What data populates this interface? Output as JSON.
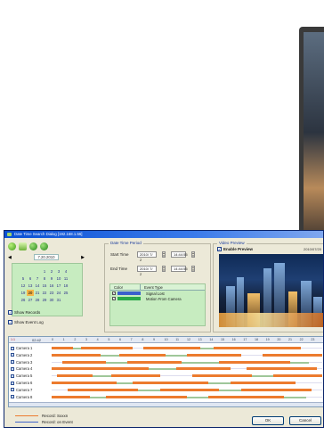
{
  "window": {
    "title": "Date Time Search Dialog  [192.168.1.56]"
  },
  "toolbar": {
    "icons": [
      "refresh-icon",
      "calendar-icon",
      "play-icon",
      "record-icon"
    ]
  },
  "calendar": {
    "nav_prev": "◀",
    "nav_next": "▶",
    "month_label": "7.20.2010",
    "days": [
      "",
      "",
      "",
      "1",
      "2",
      "3",
      "4",
      "5",
      "6",
      "7",
      "8",
      "9",
      "10",
      "11",
      "12",
      "13",
      "14",
      "15",
      "16",
      "17",
      "18",
      "19",
      "20",
      "21",
      "22",
      "23",
      "24",
      "25",
      "26",
      "27",
      "28",
      "29",
      "30",
      "31",
      "",
      ""
    ],
    "selected_day": "20"
  },
  "options": {
    "show_records": "Show Records",
    "show_event_log": "Show Event Log"
  },
  "date_time_period": {
    "title": "Date Time Period",
    "start_label": "Start Time",
    "start_date": "2010/ 7/ 2",
    "start_time": "14:44:55",
    "end_label": "End Time",
    "end_date": "2010/ 7/ 2",
    "end_time": "14:44:55"
  },
  "event_table": {
    "headers": [
      "Color",
      "Event Type"
    ],
    "rows": [
      {
        "color": "#3a5fcd",
        "label": "Signal Lost"
      },
      {
        "color": "#2aa84a",
        "label": "Motion From Camera"
      }
    ]
  },
  "video_preview": {
    "title": "Video Preview",
    "enable_label": "Enable Preview",
    "date": "2010/07/20"
  },
  "timeline": {
    "zoom": "1:1",
    "time": "02:42",
    "hours": [
      "0",
      "1",
      "2",
      "3",
      "4",
      "5",
      "6",
      "7",
      "8",
      "9",
      "10",
      "11",
      "12",
      "13",
      "14",
      "15",
      "16",
      "17",
      "18",
      "19",
      "20",
      "21",
      "22",
      "23"
    ],
    "cameras": [
      {
        "name": "Camera 1",
        "schedule": [
          [
            0.0,
            0.08
          ],
          [
            0.11,
            0.3
          ],
          [
            0.34,
            0.55
          ],
          [
            0.6,
            0.92
          ]
        ],
        "event": [
          [
            0.08,
            0.11
          ],
          [
            0.55,
            0.6
          ]
        ]
      },
      {
        "name": "Camera 2",
        "schedule": [
          [
            0.0,
            0.18
          ],
          [
            0.25,
            0.42
          ],
          [
            0.5,
            0.7
          ],
          [
            0.78,
            1.0
          ]
        ],
        "event": [
          [
            0.18,
            0.25
          ],
          [
            0.42,
            0.5
          ]
        ]
      },
      {
        "name": "Camera 3",
        "schedule": [
          [
            0.04,
            0.2
          ],
          [
            0.28,
            0.48
          ],
          [
            0.62,
            0.88
          ]
        ],
        "event": [
          [
            0.2,
            0.28
          ],
          [
            0.48,
            0.62
          ],
          [
            0.88,
            0.95
          ]
        ]
      },
      {
        "name": "Camera 4",
        "schedule": [
          [
            0.0,
            0.36
          ],
          [
            0.46,
            0.66
          ],
          [
            0.72,
            0.98
          ]
        ],
        "event": [
          [
            0.36,
            0.46
          ]
        ]
      },
      {
        "name": "Camera 5",
        "schedule": [
          [
            0.02,
            0.15
          ],
          [
            0.22,
            0.4
          ],
          [
            0.52,
            0.74
          ],
          [
            0.82,
            1.0
          ]
        ],
        "event": [
          [
            0.15,
            0.22
          ],
          [
            0.74,
            0.82
          ]
        ]
      },
      {
        "name": "Camera 6",
        "schedule": [
          [
            0.0,
            0.24
          ],
          [
            0.3,
            0.58
          ],
          [
            0.66,
            0.9
          ]
        ],
        "event": [
          [
            0.24,
            0.3
          ],
          [
            0.58,
            0.66
          ]
        ]
      },
      {
        "name": "Camera 7",
        "schedule": [
          [
            0.06,
            0.32
          ],
          [
            0.4,
            0.62
          ],
          [
            0.7,
            0.96
          ]
        ],
        "event": [
          [
            0.32,
            0.4
          ],
          [
            0.62,
            0.7
          ]
        ]
      },
      {
        "name": "Camera 8",
        "schedule": [
          [
            0.0,
            0.14
          ],
          [
            0.2,
            0.5
          ],
          [
            0.58,
            0.86
          ]
        ],
        "event": [
          [
            0.14,
            0.2
          ],
          [
            0.5,
            0.58
          ],
          [
            0.86,
            0.94
          ]
        ]
      }
    ]
  },
  "legend": {
    "schedule_label": "Record: Sxxxn",
    "schedule_color": "#ec7b2e",
    "event_label": "Record: on Event",
    "event_color": "#3e63c9"
  },
  "buttons": {
    "ok": "OK",
    "cancel": "Cancel"
  }
}
